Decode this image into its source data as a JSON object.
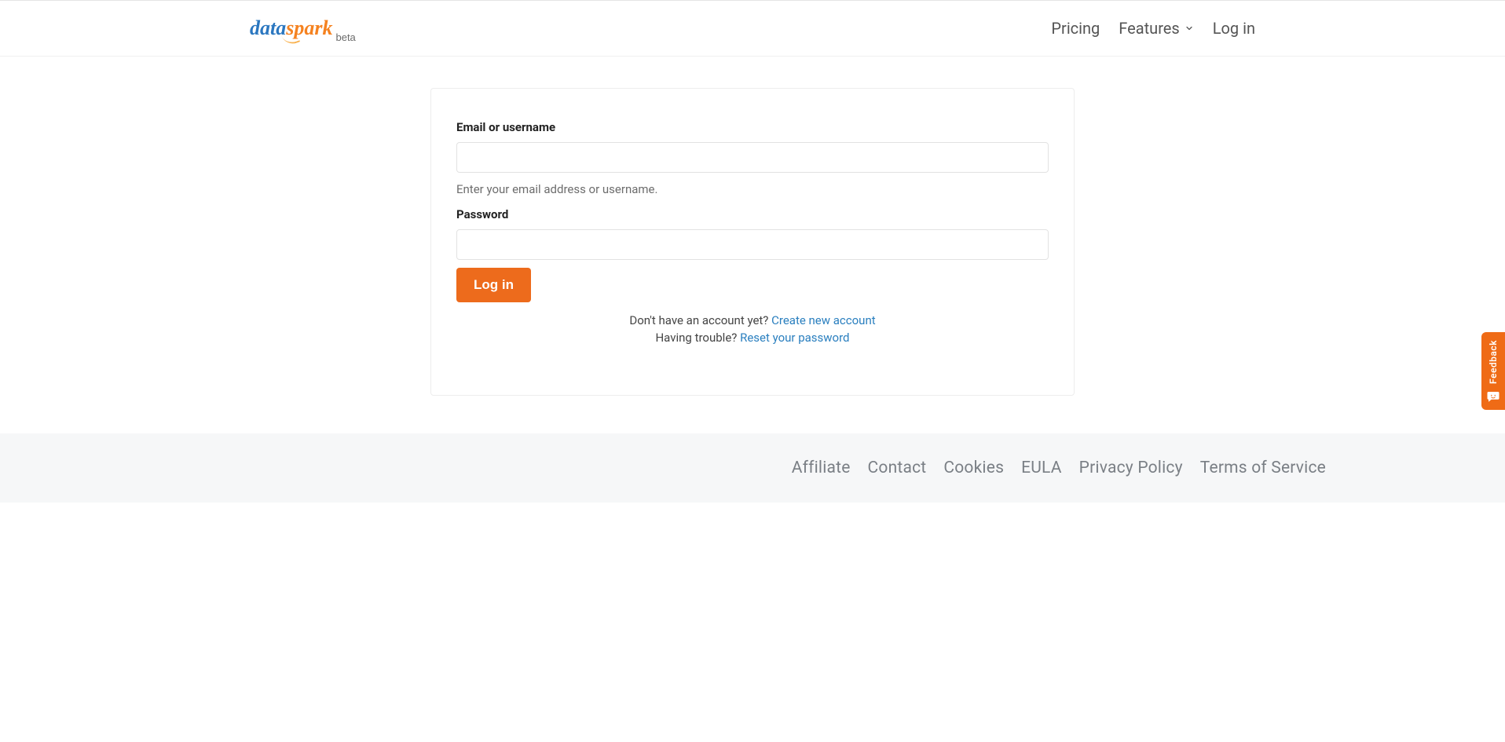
{
  "brand": {
    "part1": "data",
    "part2": "spark",
    "badge": "beta"
  },
  "nav": {
    "pricing": "Pricing",
    "features": "Features",
    "login": "Log in"
  },
  "form": {
    "email_label": "Email or username",
    "email_value": "",
    "email_help": "Enter your email address or username.",
    "password_label": "Password",
    "password_value": "",
    "submit": "Log in",
    "no_account_text": "Don't have an account yet? ",
    "create_link": "Create new account",
    "trouble_text": "Having trouble? ",
    "reset_link": "Reset your password"
  },
  "footer": {
    "links": [
      "Affiliate",
      "Contact",
      "Cookies",
      "EULA",
      "Privacy Policy",
      "Terms of Service"
    ]
  },
  "feedback": {
    "label": "Feedback"
  }
}
